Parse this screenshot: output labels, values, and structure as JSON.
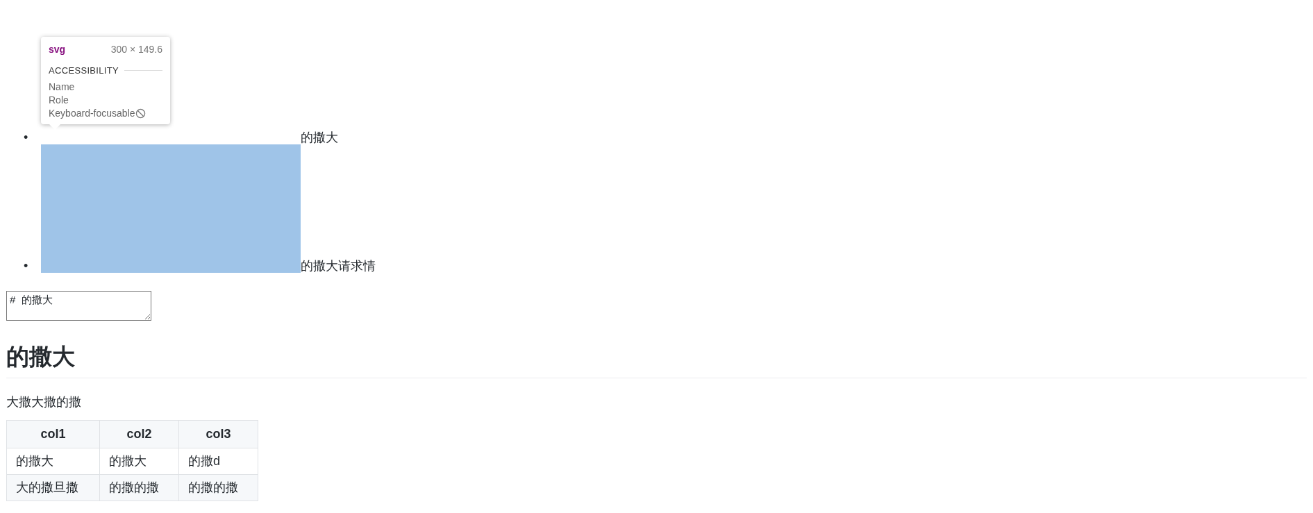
{
  "tooltip": {
    "tag": "svg",
    "size": "300 × 149.6",
    "section": "ACCESSIBILITY",
    "rows": [
      {
        "label": "Name"
      },
      {
        "label": "Role"
      },
      {
        "label": "Keyboard-focusable",
        "focusable": false
      }
    ]
  },
  "list": [
    {
      "marker": "•",
      "text": "的撒大",
      "highlighted": false
    },
    {
      "marker": "•",
      "text": "的撒大请求情",
      "highlighted": true
    }
  ],
  "textarea": {
    "value": "#  的撒大"
  },
  "heading": "的撒大",
  "paragraph": "大撒大撒的撒",
  "table": {
    "columns": [
      "col1",
      "col2",
      "col3"
    ],
    "rows": [
      [
        "的撒大",
        "的撒大",
        "的撒d"
      ],
      [
        "大的撒旦撒",
        "的撒的撒",
        "的撒的撒"
      ]
    ]
  }
}
